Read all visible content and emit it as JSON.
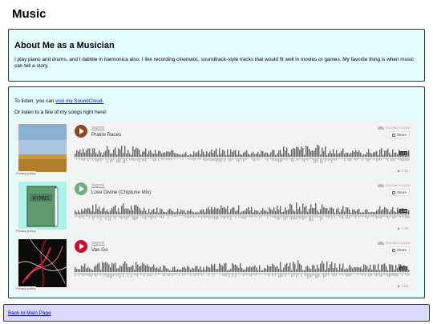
{
  "page": {
    "title": "Music"
  },
  "about": {
    "title": "About Me as a Musician",
    "text": "I play piano and drums, and I dabble in harmonica also. I like recording cinematic, soundtrack-style tracks that would fit well in movies or games. My favorite thing is when music can tell a story."
  },
  "listen": {
    "prefix": "To listen, you can ",
    "link": "visit my SoundCloud.",
    "few": "Or listen to a few of my songs right here!"
  },
  "embeds": [
    {
      "artist": "dagmei",
      "title": "Prairie Races",
      "duration": "1:12",
      "plays": "▶ 1:12",
      "privacy": "Privacy policy",
      "brand": "SOUNDCLOUD",
      "share": "Share",
      "art_icon": "prairie-landscape",
      "play_color": "#8a4a1f",
      "progress": 0.0
    },
    {
      "artist": "dagmei",
      "title": "Love Divine (Chiptune Mix)",
      "duration": "1:38",
      "plays": "▶ 1:38",
      "privacy": "Privacy policy",
      "brand": "SOUNDCLOUD",
      "share": "Share",
      "art_icon": "hymns-book",
      "art_text": "HYMNS",
      "play_color": "#6fae7f",
      "progress": 0.0
    },
    {
      "artist": "dagmei",
      "title": "Van Go",
      "duration": "1:53",
      "plays": "▶ 1:53",
      "privacy": "Privacy policy",
      "brand": "SOUNDCLOUD",
      "share": "Share",
      "art_icon": "abstract-red-swirl",
      "play_color": "#c8102e",
      "progress": 0.0
    }
  ],
  "footer": {
    "back_link": "Back to Main Page"
  }
}
